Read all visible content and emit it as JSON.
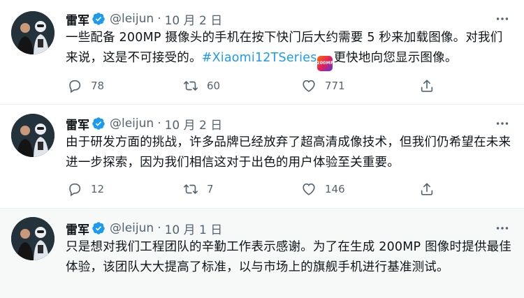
{
  "tweets": [
    {
      "author": "雷军",
      "handle": "@leijun",
      "separator": "·",
      "date": "10 月 2 日",
      "text_before": "一些配备 200MP 摄像头的手机在按下快门后大约需要 5 秒来加载图像。对我们来说，这是不可接受的。",
      "hashtag": "#Xiaomi12TSeries",
      "emoji": "200MP",
      "text_after": "更快地向您显示图像。",
      "replies": "78",
      "retweets": "60",
      "likes": "771"
    },
    {
      "author": "雷军",
      "handle": "@leijun",
      "separator": "·",
      "date": "10 月 2 日",
      "text": "由于研发方面的挑战，许多品牌已经放弃了超高清成像技术，但我们仍希望在未来进一步探索，因为我们相信这对于出色的用户体验至关重要。",
      "replies": "12",
      "retweets": "7",
      "likes": "146"
    },
    {
      "author": "雷军",
      "handle": "@leijun",
      "separator": "·",
      "date": "10 月 1 日",
      "text": "只是想对我们工程团队的辛勤工作表示感谢。为了在生成 200MP 图像时提供最佳体验，该团队大大提高了标准，以与市场上的旗舰手机进行基准测试。"
    }
  ],
  "colors": {
    "accent": "#1d9bf0",
    "secondary_text": "#536471",
    "primary_text": "#0f1419",
    "highlight_bg": "#f7f9f9"
  },
  "icons": {
    "verified": "verified-badge-icon",
    "more": "more-options-icon",
    "reply": "reply-icon",
    "retweet": "retweet-icon",
    "like": "like-icon",
    "share": "share-icon"
  }
}
